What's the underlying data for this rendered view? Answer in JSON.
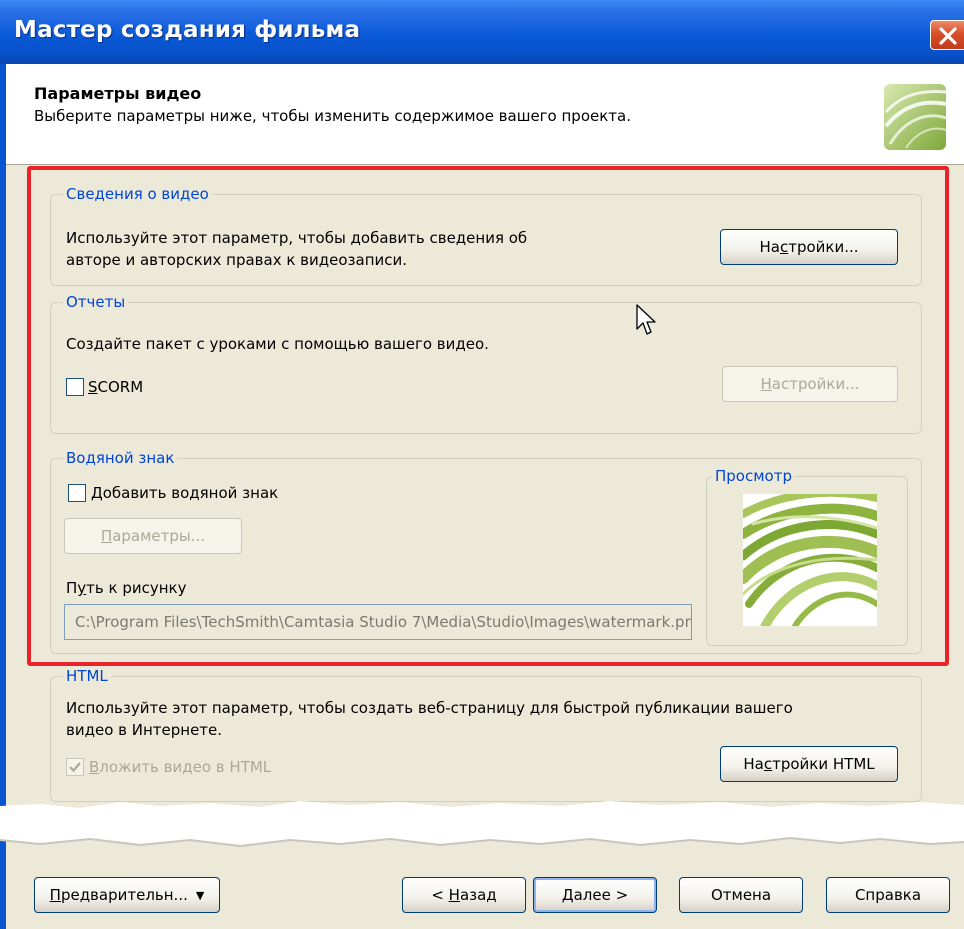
{
  "window": {
    "title": "Мастер создания фильма"
  },
  "header": {
    "title": "Параметры видео",
    "description": "Выберите параметры ниже, чтобы изменить содержимое вашего проекта."
  },
  "video_info": {
    "group_label": "Сведения о видео",
    "description_line1": "Используйте этот параметр, чтобы добавить сведения об",
    "description_line2": "авторе и авторских правах к видеозаписи.",
    "settings_button_pre": "На",
    "settings_button_u": "с",
    "settings_button_post": "тройки..."
  },
  "reports": {
    "group_label": "Отчеты",
    "description": "Создайте пакет с уроками с помощью вашего видео.",
    "scorm_u": "S",
    "scorm_rest": "CORM",
    "scorm_checked": false,
    "settings_button_u": "Н",
    "settings_button_rest": "астройки..."
  },
  "watermark": {
    "group_label": "Водяной знак",
    "add_u": "Д",
    "add_rest": "обавить водяной знак",
    "add_checked": false,
    "params_button_u": "П",
    "params_button_rest": "араметры...",
    "path_label_pre": "П",
    "path_label_u": "у",
    "path_label_post": "ть к рисунку",
    "path_value": "C:\\Program Files\\TechSmith\\Camtasia Studio 7\\Media\\Studio\\Images\\watermark.png",
    "preview_label": "Просмотр"
  },
  "html": {
    "group_label": "HTML",
    "description_line1": "Используйте этот параметр, чтобы создать веб-страницу для быстрой публикации вашего",
    "description_line2": "видео в Интернете.",
    "embed_u": "В",
    "embed_rest": "ложить видео в HTML",
    "embed_checked": true,
    "settings_button_pre": "На",
    "settings_button_u": "с",
    "settings_button_post": "тройки HTML"
  },
  "footer": {
    "preview_u": "П",
    "preview_rest": "редварительн...",
    "back_pre": "< ",
    "back_u": "Н",
    "back_rest": "азад",
    "next_u": "Д",
    "next_rest": "алее >",
    "cancel": "Отмена",
    "help": "Справка"
  },
  "colors": {
    "title_bar": "#0a5ad8",
    "group_label": "#0046d5",
    "highlight": "#e8242a",
    "dialog_bg": "#ece9d8"
  }
}
